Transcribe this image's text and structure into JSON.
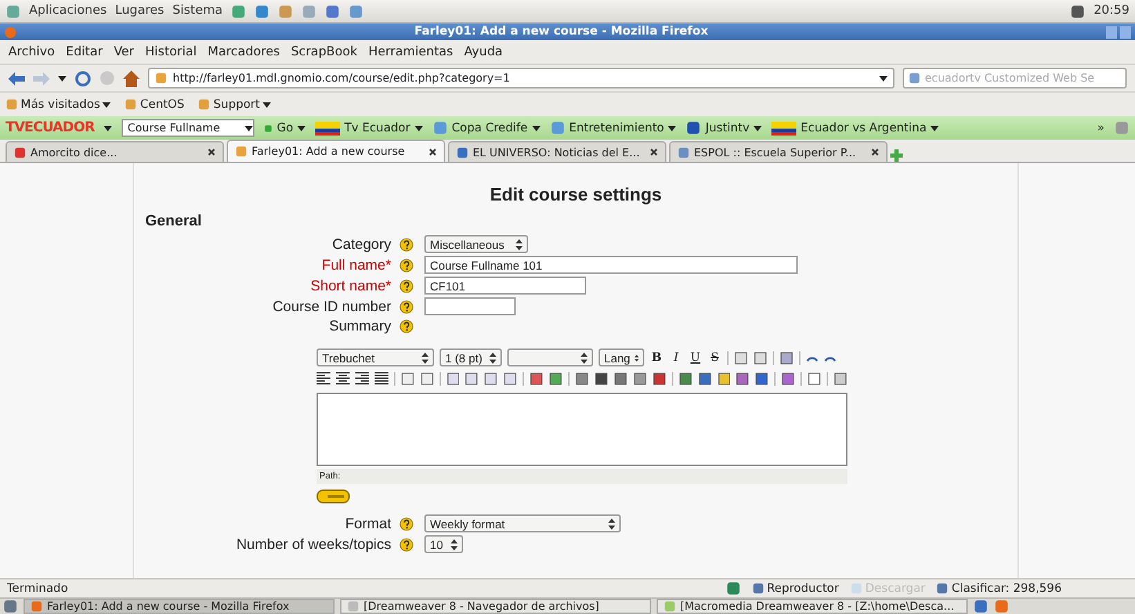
{
  "top_panel": {
    "menus": [
      "Aplicaciones",
      "Lugares",
      "Sistema"
    ],
    "clock": "20:59"
  },
  "window": {
    "title": "Farley01: Add a new course - Mozilla Firefox"
  },
  "menubar": [
    "Archivo",
    "Editar",
    "Ver",
    "Historial",
    "Marcadores",
    "ScrapBook",
    "Herramientas",
    "Ayuda"
  ],
  "navbar": {
    "url": "http://farley01.mdl.gnomio.com/course/edit.php?category=1",
    "search_placeholder": "ecuadortv Customized Web Se"
  },
  "bookmarks": [
    {
      "label": "Más visitados",
      "dropdown": true
    },
    {
      "label": "CentOS",
      "dropdown": false
    },
    {
      "label": "Support",
      "dropdown": true
    }
  ],
  "tv_toolbar": {
    "logo": "TVECUADOR",
    "search": "Course Fullname",
    "go": "Go",
    "items": [
      "Tv Ecuador",
      "Copa Credife",
      "Entretenimiento",
      "Justintv",
      "Ecuador vs Argentina"
    ],
    "more": "»"
  },
  "tabs": [
    {
      "label": "Amorcito dice...",
      "selected": false
    },
    {
      "label": "Farley01: Add a new course",
      "selected": true
    },
    {
      "label": "EL UNIVERSO: Noticias del E...",
      "selected": false
    },
    {
      "label": "ESPOL :: Escuela Superior P...",
      "selected": false
    }
  ],
  "page": {
    "heading": "Edit course settings",
    "section": "General",
    "fields": [
      {
        "kind": "select",
        "label": "Category",
        "required": false,
        "value": "Miscellaneous"
      },
      {
        "kind": "text",
        "label": "Full name*",
        "required": true,
        "value": "Course Fullname 101"
      },
      {
        "kind": "text",
        "label": "Short name*",
        "required": true,
        "value": "CF101"
      },
      {
        "kind": "text",
        "label": "Course ID number",
        "required": false
      },
      {
        "kind": "editor",
        "label": "Summary",
        "required": false
      }
    ],
    "editor": {
      "font": "Trebuchet",
      "size": "1 (8 pt)",
      "lang": "Lang",
      "format_buttons": [
        "B",
        "I",
        "U",
        "S"
      ],
      "path": "Path:"
    },
    "more_fields": [
      {
        "kind": "wide_select",
        "label": "Format",
        "value": "Weekly format"
      },
      {
        "kind": "spin",
        "label": "Number of weeks/topics",
        "value": "10"
      }
    ]
  },
  "status_bar": {
    "text": "Terminado",
    "items": [
      {
        "label": "Reproductor",
        "disabled": false
      },
      {
        "label": "Descargar",
        "disabled": true
      },
      {
        "label": "Clasificar: 298,596",
        "disabled": false
      }
    ]
  },
  "taskbar": [
    {
      "label": "Farley01: Add a new course - Mozilla Firefox",
      "selected": true
    },
    {
      "label": "[Dreamweaver 8 - Navegador de archivos]",
      "selected": false
    },
    {
      "label": "[Macromedia Dreamweaver 8 - [Z:\\home\\Desca...",
      "selected": false
    }
  ]
}
